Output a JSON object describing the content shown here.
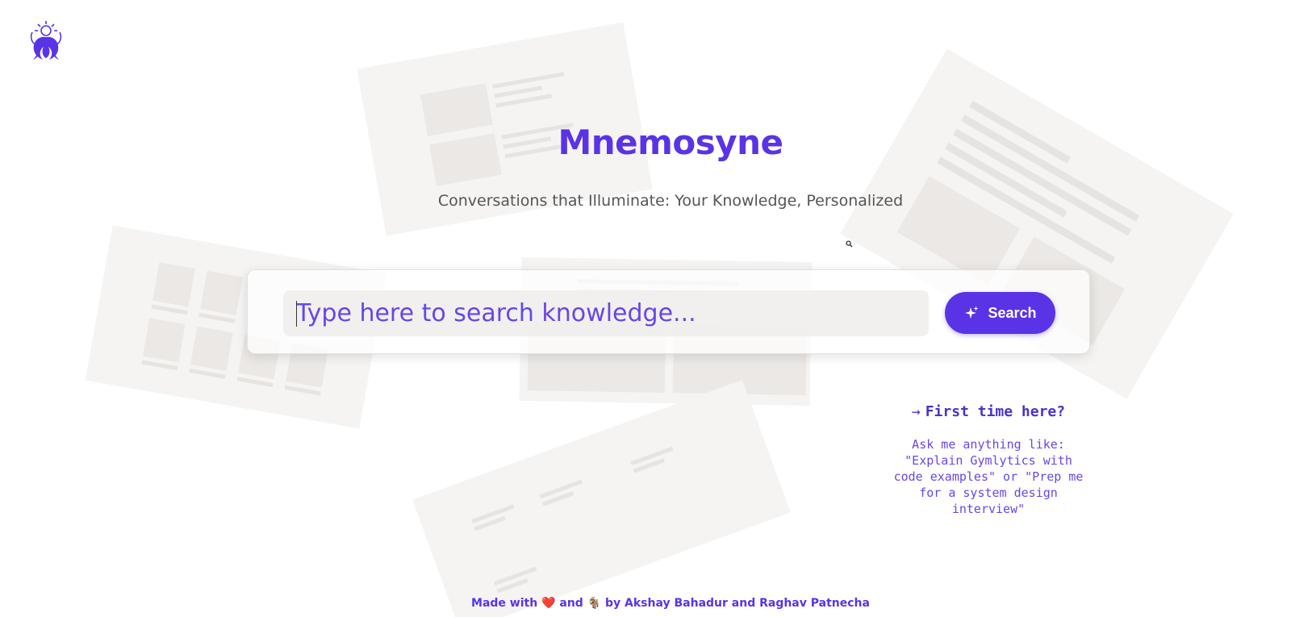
{
  "app": {
    "title": "Mnemosyne",
    "subtitle": "Conversations that Illuminate: Your Knowledge, Personalized"
  },
  "logo": {
    "icon": "mnemosyne-logo-icon"
  },
  "search": {
    "placeholder": "Type here to search knowledge...",
    "value": "",
    "button_label": "Search",
    "button_icon": "sparkle-icon"
  },
  "first_time": {
    "heading": "First time here?",
    "arrow": "→",
    "body": "Ask me anything like: \"Explain Gymlytics with code examples\" or \"Prep me for a system design interview\""
  },
  "footer": {
    "prefix": "Made with",
    "heart": "❤️",
    "and": "and",
    "goat": "🐐",
    "suffix": "by Akshay Bahadur and Raghav Patnecha"
  },
  "colors": {
    "accent": "#5a33e6",
    "text_muted": "#555555",
    "background": "#ffffff"
  }
}
